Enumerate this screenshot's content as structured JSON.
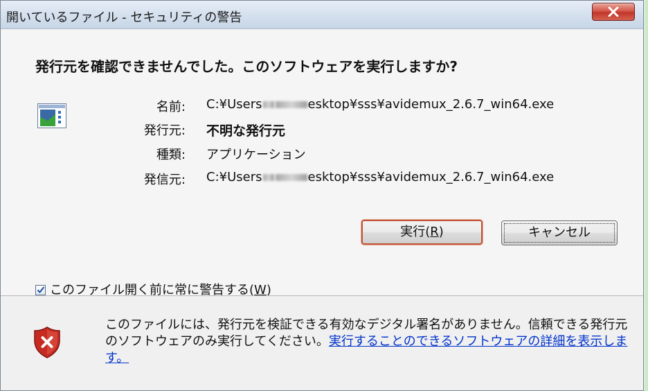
{
  "window": {
    "title": "開いているファイル - セキュリティの警告",
    "close_label": "X"
  },
  "question": "発行元を確認できませんでした。このソフトウェアを実行しますか?",
  "app_icon": "application-icon",
  "info": {
    "name_label": "名前:",
    "name_prefix": "C:¥Users",
    "name_suffix": "esktop¥sss¥avidemux_2.6.7_win64.exe",
    "publisher_label": "発行元:",
    "publisher_value": "不明な発行元",
    "type_label": "種類:",
    "type_value": "アプリケーション",
    "from_label": "発信元:",
    "from_prefix": "C:¥Users",
    "from_suffix": "esktop¥sss¥avidemux_2.6.7_win64.exe"
  },
  "buttons": {
    "run_text": "実行(",
    "run_key": "R",
    "run_close": ")",
    "cancel": "キャンセル"
  },
  "checkbox": {
    "checked": true,
    "label_text": "このファイル開く前に常に警告する(",
    "label_key": "W",
    "label_close": ")"
  },
  "footer": {
    "shield_icon": "security-shield-error-icon",
    "text": "このファイルには、発行元を検証できる有効なデジタル署名がありません。信頼できる発行元のソフトウェアのみ実行してください。",
    "link": "実行することのできるソフトウェアの詳細を表示します。"
  }
}
